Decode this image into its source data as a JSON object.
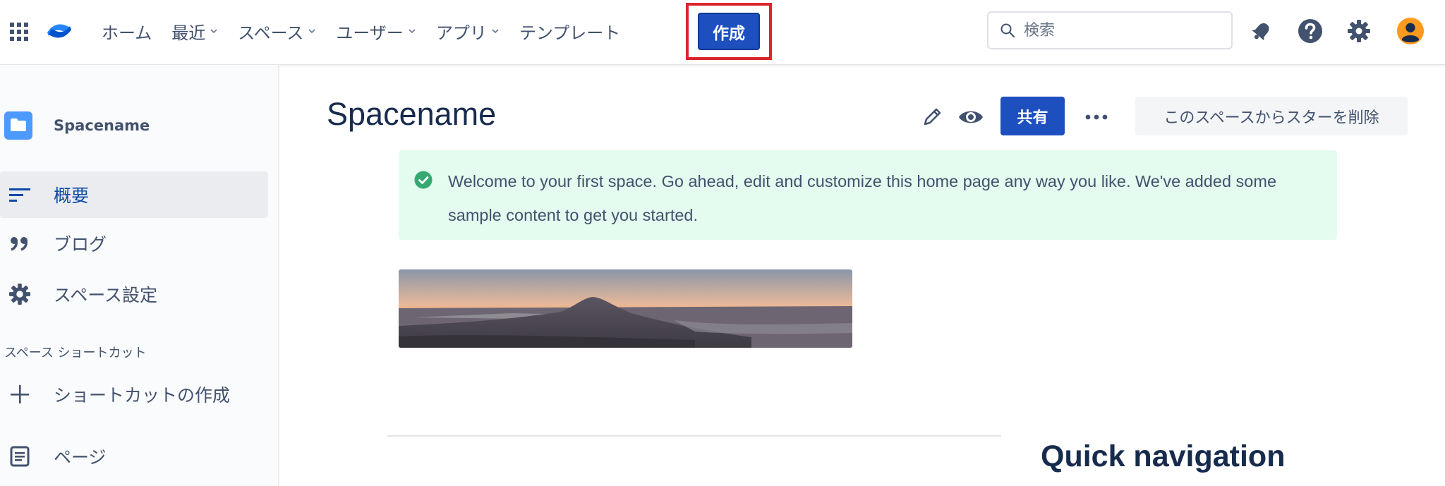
{
  "topnav": {
    "items": [
      {
        "label": "ホーム",
        "has_dropdown": false
      },
      {
        "label": "最近",
        "has_dropdown": true
      },
      {
        "label": "スペース",
        "has_dropdown": true
      },
      {
        "label": "ユーザー",
        "has_dropdown": true
      },
      {
        "label": "アプリ",
        "has_dropdown": true
      },
      {
        "label": "テンプレート",
        "has_dropdown": false
      }
    ],
    "create_label": "作成",
    "search_placeholder": "検索",
    "icons": [
      "app-switcher-icon",
      "confluence-logo",
      "notifications-icon",
      "help-icon",
      "settings-icon",
      "user-avatar"
    ]
  },
  "sidebar": {
    "space_name": "Spacename",
    "items": [
      {
        "label": "概要",
        "icon": "overview-icon",
        "active": true
      },
      {
        "label": "ブログ",
        "icon": "quote-icon",
        "active": false
      },
      {
        "label": "スペース設定",
        "icon": "gear-icon",
        "active": false
      }
    ],
    "shortcuts_heading": "スペース ショートカット",
    "add_shortcut_label": "ショートカットの作成",
    "pages_label": "ページ"
  },
  "main": {
    "title": "Spacename",
    "share_label": "共有",
    "unstar_label": "このスペースからスターを削除",
    "welcome_message": "Welcome to your first space. Go ahead, edit and customize this home page any way you like. We've added some sample content to get you started.",
    "quick_nav_heading": "Quick navigation"
  },
  "colors": {
    "primary_button": "#1d4fbf",
    "highlight_border": "#d9262a",
    "success_bg": "#e3fcef",
    "success_icon": "#36b37e",
    "text": "#172b4d",
    "muted_text": "#42526e"
  }
}
